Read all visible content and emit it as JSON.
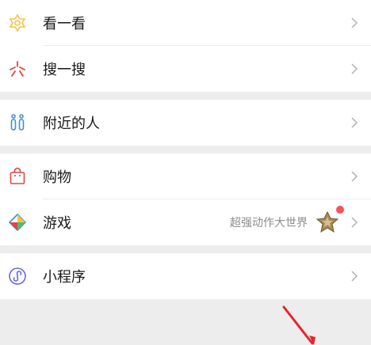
{
  "rows": {
    "look": {
      "label": "看一看",
      "icon": "look-icon"
    },
    "search": {
      "label": "搜一搜",
      "icon": "search-icon"
    },
    "nearby": {
      "label": "附近的人",
      "icon": "nearby-people-icon"
    },
    "shopping": {
      "label": "购物",
      "icon": "shopping-bag-icon"
    },
    "games": {
      "label": "游戏",
      "subtext": "超强动作大世界",
      "icon": "games-icon",
      "has_badge": true
    },
    "mini_programs": {
      "label": "小程序",
      "icon": "mini-program-icon"
    }
  },
  "colors": {
    "background": "#ededed",
    "row_bg": "#ffffff",
    "text": "#191919",
    "subtext": "#8c8c8c",
    "chevron": "#b2b2b2",
    "badge_red": "#fa5151",
    "look_icon": "#f6c343",
    "search_icon": "#e64340",
    "nearby_icon": "#3d8fd9",
    "shopping_icon": "#e64340",
    "mini_program_icon": "#6467f0",
    "annotation_arrow": "#e8232b"
  }
}
